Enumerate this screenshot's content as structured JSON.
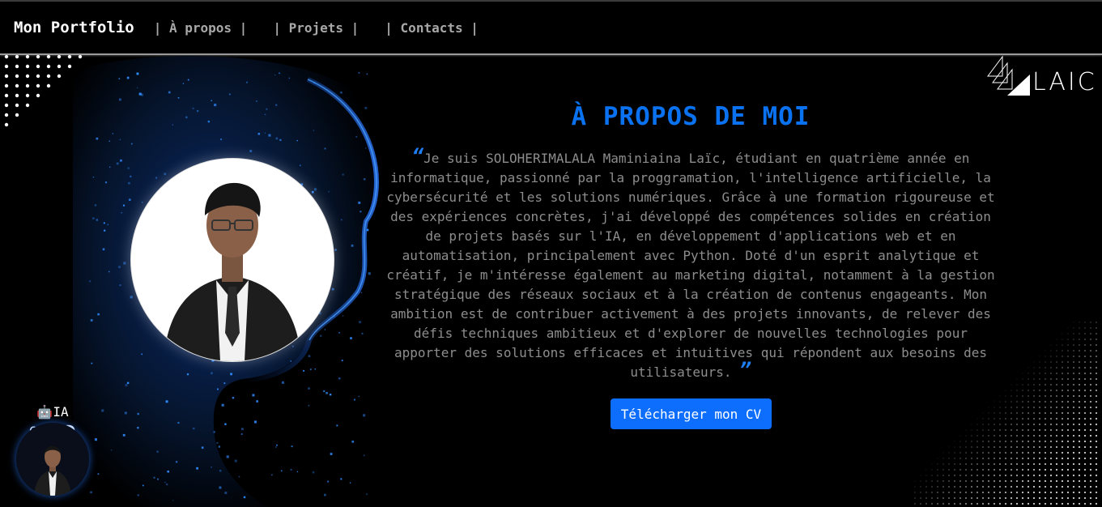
{
  "header": {
    "brand": "Mon Portfolio",
    "nav": [
      {
        "label": "| À propos |"
      },
      {
        "label": "| Projets |"
      },
      {
        "label": "| Contacts |"
      }
    ]
  },
  "about": {
    "title": "À PROPOS DE MOI",
    "open_quote": "“",
    "text": "Je suis SOLOHERIMALALA Maminiaina Laïc, étudiant en quatrième année en informatique, passionné par la proggramation, l'intelligence artificielle, la cybersécurité et les solutions numériques. Grâce à une formation rigoureuse et des expériences concrètes, j'ai développé des compétences solides en création de projets basés sur l'IA, en développement d'applications web et en automatisation, principalement avec Python. Doté d'un esprit analytique et créatif, je m'intéresse également au marketing digital, notamment à la gestion stratégique des réseaux sociaux et à la création de contenus engageants. Mon ambition est de contribuer activement à des projets innovants, de relever des défis techniques ambitieux et d'explorer de nouvelles technologies pour apporter des solutions efficaces et intuitives qui répondent aux besoins des utilisateurs.",
    "close_quote": "”",
    "cv_button": "Télécharger mon CV"
  },
  "logo": {
    "text": "LAIC"
  },
  "chat": {
    "icon": "robot-icon",
    "label": "IA Chat",
    "icon2": "speech-bubble-icon"
  },
  "colors": {
    "accent": "#0d6efd",
    "title": "#0a72f0",
    "text": "#8d8d8d",
    "nav": "#a8a8a8"
  }
}
